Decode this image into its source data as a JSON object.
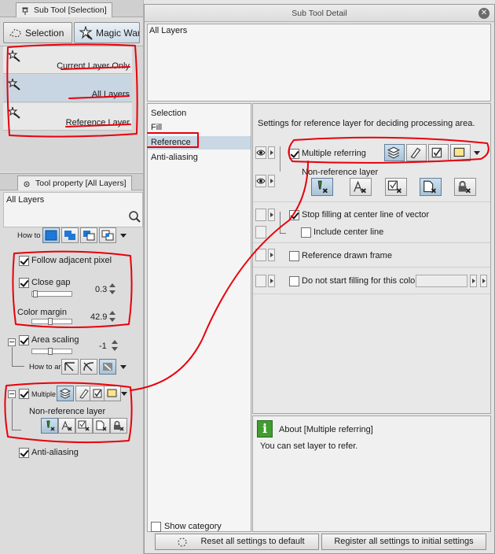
{
  "sub_tool_panel": {
    "tab_title": "Sub Tool [Selection]",
    "tool_tabs": [
      {
        "label": "Selection",
        "icon": "dashed-lasso-icon",
        "active": false
      },
      {
        "label": "Magic Wand",
        "icon": "magic-wand-icon",
        "active": true
      }
    ],
    "items": [
      {
        "label": "Current Layer Only",
        "icon": "magic-wand-icon"
      },
      {
        "label": "All Layers",
        "icon": "magic-wand-icon",
        "selected": true
      },
      {
        "label": "Reference Layer",
        "icon": "magic-wand-icon"
      }
    ]
  },
  "tool_property_panel": {
    "tab_title": "Tool property [All Layers]",
    "tool_name": "All Layers",
    "how_to_label": "How to",
    "follow_adjacent_pixel": {
      "label": "Follow adjacent pixel",
      "checked": true
    },
    "close_gap": {
      "label": "Close gap",
      "checked": true,
      "value": "0.3"
    },
    "color_margin": {
      "label": "Color margin",
      "value": "42.9"
    },
    "area_scaling": {
      "label": "Area scaling",
      "checked": true,
      "value": "-1"
    },
    "how_to_2_label": "How to ar",
    "multiple_label": "Multiple",
    "non_reference_label": "Non-reference layer",
    "anti_aliasing": {
      "label": "Anti-aliasing",
      "checked": true
    }
  },
  "sub_tool_detail": {
    "title": "Sub Tool Detail",
    "preview_label": "All Layers",
    "categories": [
      {
        "label": "Selection"
      },
      {
        "label": "Fill"
      },
      {
        "label": "Reference",
        "selected": true
      },
      {
        "label": "Anti-aliasing"
      }
    ],
    "settings_description": "Settings for reference layer for deciding processing area.",
    "multiple_referring": {
      "label": "Multiple referring",
      "checked": true
    },
    "non_reference_layer": "Non-reference layer",
    "stop_filling": {
      "label": "Stop filling at center line of vector",
      "checked": true
    },
    "include_center_line": {
      "label": "Include center line",
      "checked": false
    },
    "reference_drawn_frame": {
      "label": "Reference drawn frame",
      "checked": false
    },
    "do_not_start_filling": {
      "label": "Do not start filling for this color",
      "checked": false
    },
    "about_title": "About [Multiple referring]",
    "about_text": "You can set layer to refer.",
    "show_category": "Show category",
    "reset_button": "Reset all settings to default",
    "register_button": "Register all settings to initial settings"
  },
  "colors": {
    "annotation": "#e8000b",
    "selection_highlight": "#c9d8e4",
    "accent_blue": "#1e78d7",
    "about_icon_green": "#3f9e2f"
  }
}
